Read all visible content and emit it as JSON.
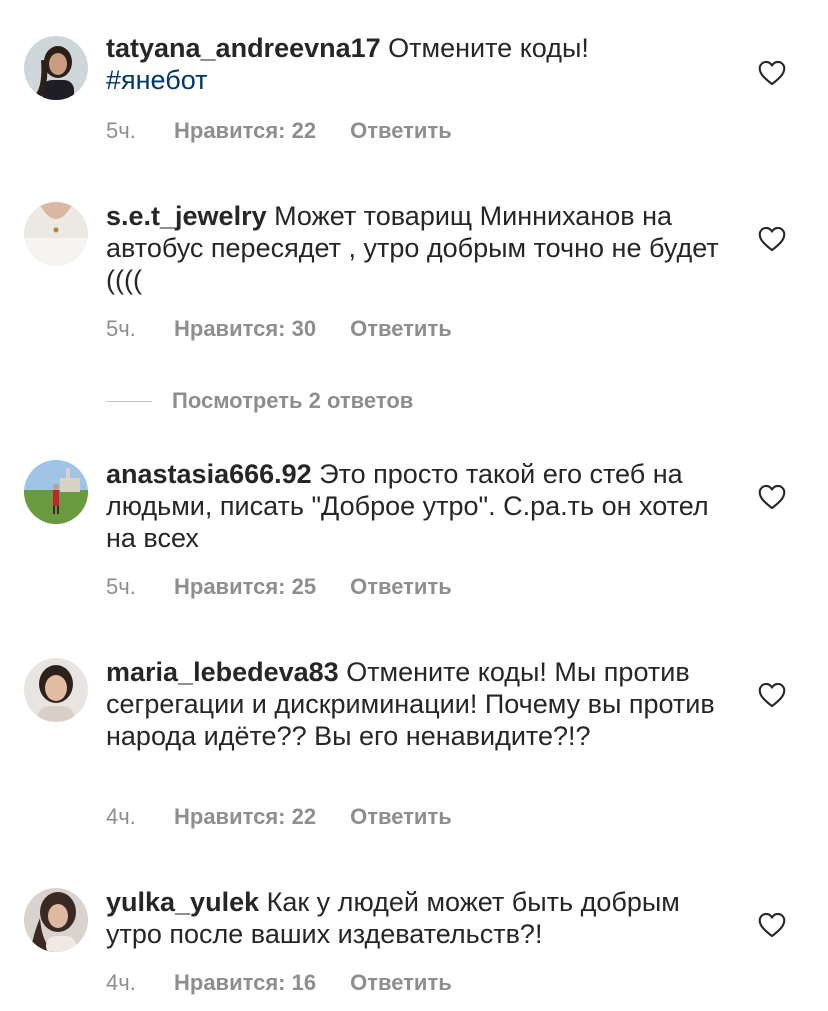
{
  "comments": [
    {
      "username": "tatyana_andreevna17",
      "text": "Отмените коды!",
      "hashtag": "#янебот",
      "time": "5ч.",
      "likes": "Нравится: 22",
      "reply": "Ответить"
    },
    {
      "username": "s.e.t_jewelry",
      "text": "Может товарищ Минниханов на автобус пересядет , утро добрым точно не будет ((((",
      "time": "5ч.",
      "likes": "Нравится: 30",
      "reply": "Ответить"
    },
    {
      "username": "anastasia666.92",
      "text": "Это просто такой его стеб на людьми, писать \"Доброе утро\". С.ра.ть он хотел на всех",
      "time": "5ч.",
      "likes": "Нравится: 25",
      "reply": "Ответить"
    },
    {
      "username": "maria_lebedeva83",
      "text": "Отмените коды! Мы против сегрегации и дискриминации! Почему вы против народа идёте?? Вы его ненавидите?!?",
      "time": "4ч.",
      "likes": "Нравится: 22",
      "reply": "Ответить"
    },
    {
      "username": "yulka_yulek",
      "text": "Как у людей может быть добрым утро после ваших издевательств?!",
      "time": "4ч.",
      "likes": "Нравится: 16",
      "reply": "Ответить"
    }
  ],
  "view_replies": "Посмотреть 2 ответов",
  "icons": {
    "like": "heart-outline-icon"
  },
  "colors": {
    "text": "#262626",
    "secondary": "#8e8e8e",
    "hashtag": "#00376b"
  }
}
